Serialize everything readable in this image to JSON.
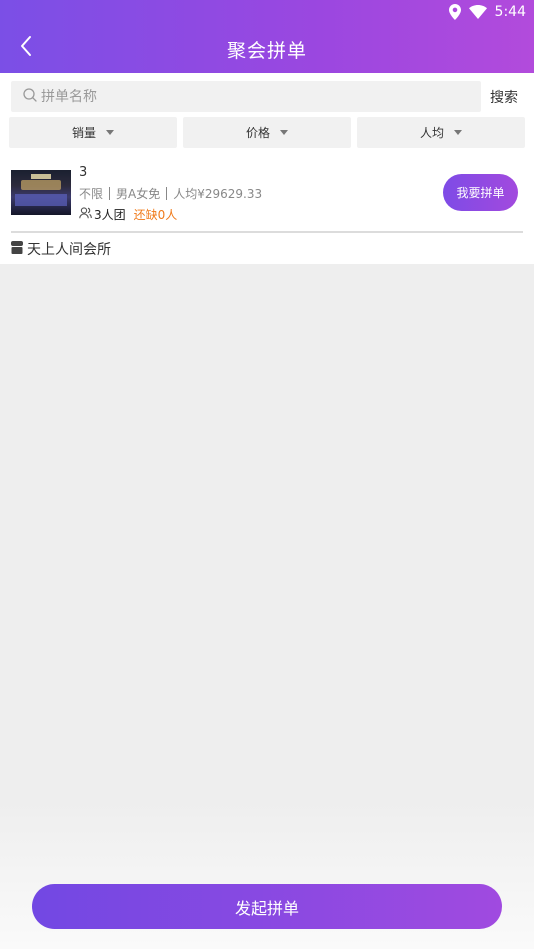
{
  "status_bar": {
    "time": "5:44",
    "icons": [
      "location-icon",
      "wifi-icon"
    ]
  },
  "header": {
    "title": "聚会拼单",
    "back_icon": "chevron-left-icon"
  },
  "search": {
    "placeholder": "拼单名称",
    "value": "",
    "button_label": "搜索"
  },
  "filters": [
    {
      "label": "销量"
    },
    {
      "label": "价格"
    },
    {
      "label": "人均"
    }
  ],
  "listing": {
    "name": "3",
    "tags": [
      "不限",
      "男A女免",
      "人均¥29629.33"
    ],
    "group_size": "3人团",
    "remaining": "还缺0人",
    "join_label": "我要拼单",
    "venue": "天上人间会所"
  },
  "footer": {
    "launch_label": "发起拼单"
  },
  "colors": {
    "accent_start": "#7b4fe6",
    "accent_end": "#b24bdc",
    "warning": "#f07a1a",
    "background": "#eeeeee"
  }
}
